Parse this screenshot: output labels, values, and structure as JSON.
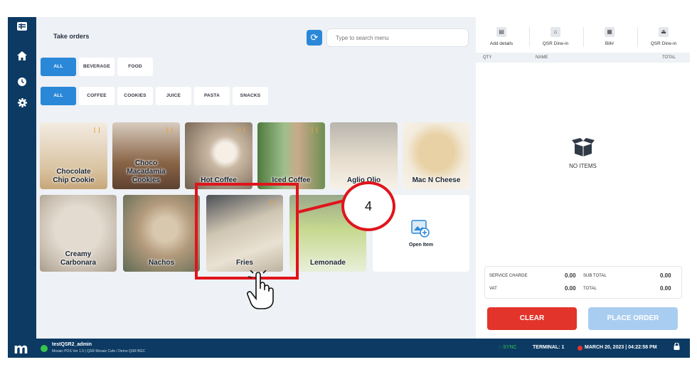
{
  "app": {
    "title": "Take orders"
  },
  "sidebar": {
    "icons": [
      "menu-icon",
      "home-icon",
      "clock-icon",
      "gear-icon"
    ]
  },
  "search": {
    "placeholder": "Type to search menu"
  },
  "categories": [
    "ALL",
    "BEVERAGE",
    "FOOD"
  ],
  "subcategories": [
    "ALL",
    "COFFEE",
    "COOKIES",
    "JUICE",
    "PASTA",
    "SNACKS"
  ],
  "menu_items": [
    {
      "label": "Chocolate Chip Cookie",
      "l1": "Chocolate",
      "l2": "Chip Cookie",
      "color": "#d9c3a1"
    },
    {
      "label": "Choco Macadamia Cookies",
      "l1": "Choco",
      "l2": "Macadamia",
      "l3": "Cookies",
      "color": "#8a6547"
    },
    {
      "label": "Hot Coffee",
      "l1": "Hot Coffee",
      "color": "#c9b8a3"
    },
    {
      "label": "Iced Coffee",
      "l1": "Iced Coffee",
      "color": "#9fbf8c"
    },
    {
      "label": "Aglio Olio",
      "l1": "Aglio Olio",
      "color": "#e6dccd"
    },
    {
      "label": "Mac N Cheese",
      "l1": "Mac N Cheese",
      "color": "#e8d1a4"
    },
    {
      "label": "Creamy Carbonara",
      "l1": "Creamy",
      "l2": "Carbonara",
      "color": "#e3dbd0"
    },
    {
      "label": "Nachos",
      "l1": "Nachos",
      "color": "#b39a7c"
    },
    {
      "label": "Fries",
      "l1": "Fries",
      "color": "#cfc5b2"
    },
    {
      "label": "Lemonade",
      "l1": "Lemonade",
      "color": "#c6d98f"
    },
    {
      "label": "Open Item",
      "l1": "Open Item",
      "color": "#ffffff"
    }
  ],
  "order_panel": {
    "actions": [
      "Add details",
      "QSR Dine-in",
      "Bill#",
      "QSR Dine-in"
    ],
    "columns": {
      "qty": "QTY",
      "name": "NAME",
      "total": "TOTAL"
    },
    "empty_text": "NO ITEMS",
    "service_charge_label": "SERVICE CHARGE",
    "service_charge": "0.00",
    "sub_total_label": "SUB TOTAL",
    "sub_total": "0.00",
    "vat_label": "VAT",
    "vat": "0.00",
    "total_label": "TOTAL",
    "total": "0.00",
    "clear_label": "CLEAR",
    "place_order_label": "PLACE ORDER"
  },
  "status": {
    "logo": "m",
    "user": "testQSR2_admin",
    "version": "Mosaic POS Ver 1.5 | QSR Mosaic Cafe / Demo QSR BGC",
    "sync": "SYNC",
    "terminal": "TERMINAL: 1",
    "datetime": "MARCH 20, 2023 | 04:22:58 PM"
  },
  "callout": {
    "number": "4"
  },
  "colors": {
    "navy": "#0c3a63",
    "accent": "#2b88d8",
    "danger": "#e2342b",
    "callout": "#e0141c"
  }
}
